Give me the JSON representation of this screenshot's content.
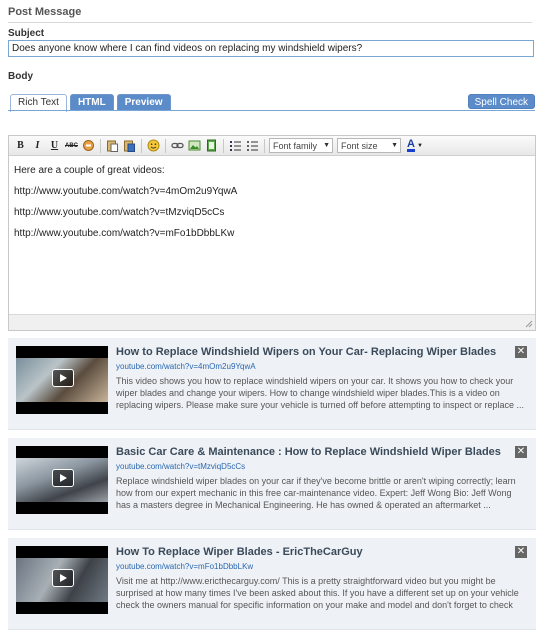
{
  "section": {
    "title": "Post Message"
  },
  "subject": {
    "label": "Subject",
    "value": "Does anyone know where I can find videos on replacing my windshield wipers?"
  },
  "body": {
    "label": "Body"
  },
  "tabs": [
    {
      "label": "Rich Text",
      "active": true
    },
    {
      "label": "HTML"
    },
    {
      "label": "Preview"
    }
  ],
  "spell_check": "Spell Check",
  "toolbar": {
    "bold": "B",
    "italic": "I",
    "underline": "U",
    "strike": "ABC",
    "font_family": "Font family",
    "font_size": "Font size",
    "font_color": "A"
  },
  "editor": {
    "lines": [
      "Here are a couple of great videos:",
      "http://www.youtube.com/watch?v=4mOm2u9YqwA",
      "http://www.youtube.com/watch?v=tMzviqD5cCs",
      "http://www.youtube.com/watch?v=mFo1bDbbLKw"
    ]
  },
  "videos": [
    {
      "title": "How to Replace Windshield Wipers on Your Car- Replacing Wiper Blades",
      "url": "youtube.com/watch?v=4mOm2u9YqwA",
      "description": "This video shows you how to replace windshield wipers on your car. It shows you how to check your wiper blades and change your wipers. How to change windshield wiper blades.This is a video on replacing wipers. Please make sure your vehicle is turned off before attempting to inspect or replace ..."
    },
    {
      "title": "Basic Car Care & Maintenance : How to Replace Windshield Wiper Blades",
      "url": "youtube.com/watch?v=tMzviqD5cCs",
      "description": "Replace windshield wiper blades on your car if they've become brittle or aren't wiping correctly; learn how from our expert mechanic in this free car-maintenance video. Expert: Jeff Wong Bio: Jeff Wong has a masters degree in Mechanical Engineering. He has owned & operated an aftermarket ..."
    },
    {
      "title": "How To Replace Wiper Blades - EricTheCarGuy",
      "url": "youtube.com/watch?v=mFo1bDbbLKw",
      "description": "Visit me at http://www.ericthecarguy.com/ This is a pretty straightforward video but you might be surprised at how many times I've been asked about this. If you have a different set up on your vehicle check the owners manual for specific information on your make and model and don't forget to check"
    }
  ]
}
